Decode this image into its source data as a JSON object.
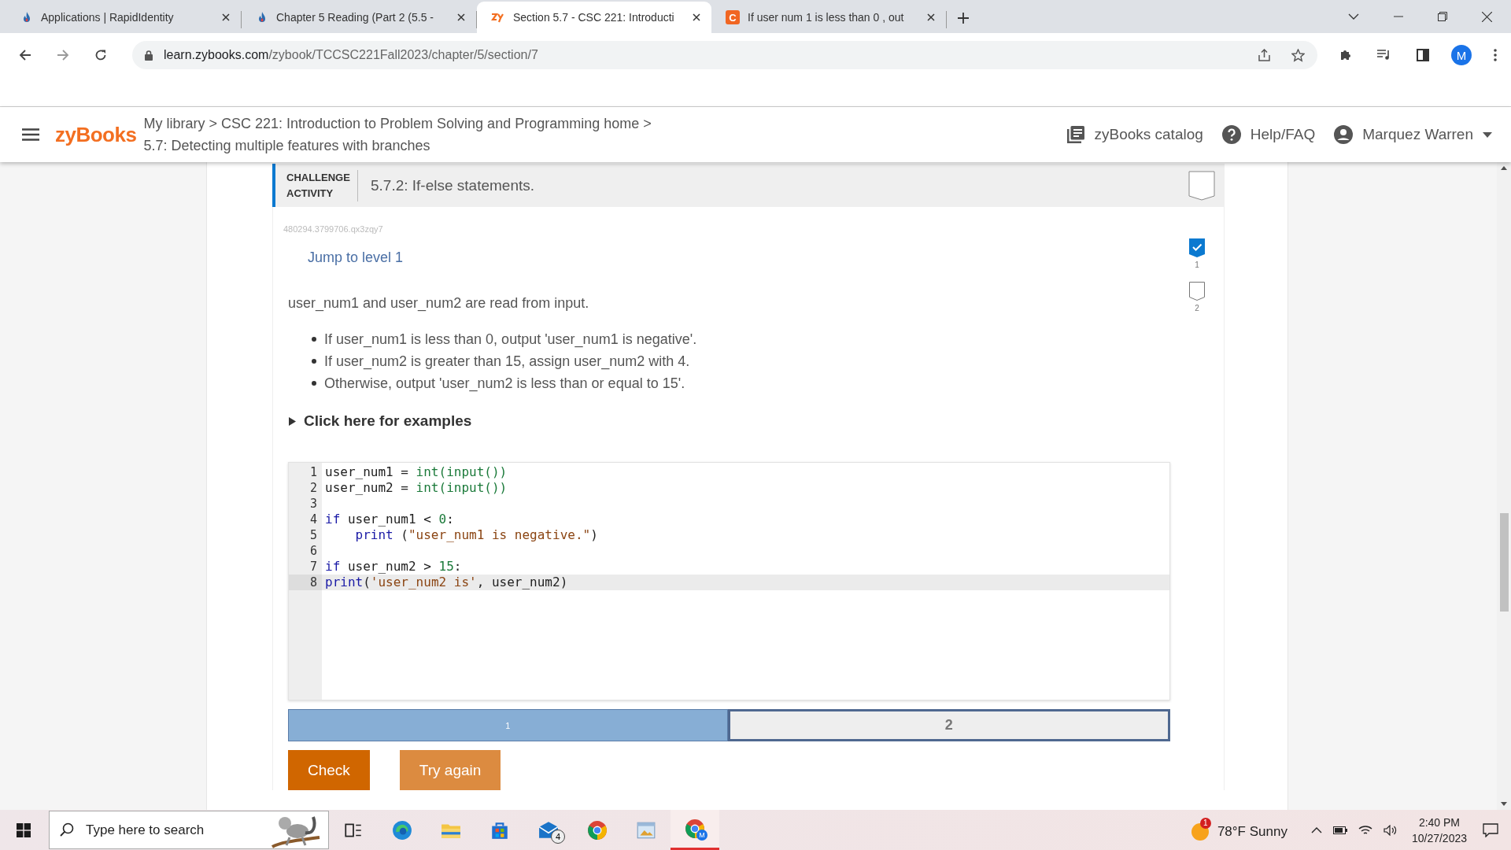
{
  "browser": {
    "tabs": [
      {
        "title": "Applications | RapidIdentity",
        "kind": "flame",
        "selected": false
      },
      {
        "title": "Chapter 5 Reading (Part 2 (5.5 -",
        "kind": "flame",
        "selected": false
      },
      {
        "title": "Section 5.7 - CSC 221: Introducti",
        "kind": "zy",
        "selected": true
      },
      {
        "title": "If user num 1 is less than 0 , out",
        "kind": "letter",
        "icon_text": "C",
        "selected": false
      }
    ],
    "url_domain": "learn.zybooks.com",
    "url_path": "/zybook/TCCSC221Fall2023/chapter/5/section/7",
    "profile": "M"
  },
  "header": {
    "logo": "zyBooks",
    "breadcrumb": "My library > CSC 221: Introduction to Problem Solving and Programming home >",
    "section": "5.7: Detecting multiple features with branches",
    "catalog": "zyBooks catalog",
    "help": "Help/FAQ",
    "user": "Marquez Warren"
  },
  "activity": {
    "label": "CHALLENGE ACTIVITY",
    "title": "5.7.2: If-else statements.",
    "completed": false,
    "code_id": "480294.3799706.qx3zqy7",
    "jump": "Jump to level 1",
    "levels": [
      {
        "label": "1",
        "completed": true
      },
      {
        "label": "2",
        "completed": false
      }
    ],
    "prompt": "user_num1 and user_num2 are read from input.",
    "bullets": [
      "If user_num1 is less than 0, output 'user_num1 is negative'.",
      "If user_num2 is greater than 15, assign user_num2 with 4.",
      "Otherwise, output 'user_num2 is less than or equal to 15'."
    ],
    "examples": {
      "label": "Click here for examples",
      "expanded": false
    },
    "code": [
      {
        "number": "1",
        "active": false,
        "tokens": [
          {
            "kind": "plain",
            "text": "user_num1 = "
          },
          {
            "kind": "builtin",
            "text": "int(input())"
          }
        ]
      },
      {
        "number": "2",
        "active": false,
        "tokens": [
          {
            "kind": "plain",
            "text": "user_num2 = "
          },
          {
            "kind": "builtin",
            "text": "int(input())"
          }
        ]
      },
      {
        "number": "3",
        "active": false
      },
      {
        "number": "4",
        "active": false,
        "tokens": [
          {
            "kind": "keyword",
            "text": "if"
          },
          {
            "kind": "plain",
            "text": " user_num1 < "
          },
          {
            "kind": "number",
            "text": "0"
          },
          {
            "kind": "plain",
            "text": ":"
          }
        ]
      },
      {
        "number": "5",
        "active": false,
        "tokens": [
          {
            "kind": "keyword",
            "text": "    print"
          },
          {
            "kind": "plain",
            "text": " ("
          },
          {
            "kind": "string",
            "text": "\"user_num1 is negative.\""
          },
          {
            "kind": "plain",
            "text": ")"
          }
        ]
      },
      {
        "number": "6",
        "active": false
      },
      {
        "number": "7",
        "active": false,
        "tokens": [
          {
            "kind": "keyword",
            "text": "if"
          },
          {
            "kind": "plain",
            "text": " user_num2 > "
          },
          {
            "kind": "number",
            "text": "15"
          },
          {
            "kind": "plain",
            "text": ":"
          }
        ]
      },
      {
        "number": "8",
        "active": true,
        "tokens": [
          {
            "kind": "keyword",
            "text": "print"
          },
          {
            "kind": "plain",
            "text": "("
          },
          {
            "kind": "string",
            "text": "'user_num2 is'"
          },
          {
            "kind": "plain",
            "text": ", user_num2)"
          }
        ]
      }
    ],
    "progress": [
      {
        "label": "1",
        "completed": true,
        "selected": false
      },
      {
        "label": "2",
        "completed": false,
        "selected": true
      }
    ],
    "buttons": [
      {
        "label": "Check",
        "kind": "primary"
      },
      {
        "label": "Try again",
        "kind": "secondary"
      }
    ]
  },
  "taskbar": {
    "search": {
      "placeholder": "Type here to search"
    },
    "apps": [
      {
        "kind": "taskview",
        "selected": false
      },
      {
        "kind": "edge",
        "selected": false
      },
      {
        "kind": "folder",
        "selected": false
      },
      {
        "kind": "store",
        "selected": false
      },
      {
        "kind": "mail",
        "badge": "4",
        "selected": false
      },
      {
        "kind": "chrome",
        "selected": false
      },
      {
        "kind": "photos",
        "selected": false
      },
      {
        "kind": "chromeprofile",
        "badge_letter": "M",
        "selected": true
      }
    ],
    "weather": {
      "badge": "1",
      "text": "78°F Sunny"
    },
    "time": "2:40 PM",
    "date": "10/27/2023"
  }
}
